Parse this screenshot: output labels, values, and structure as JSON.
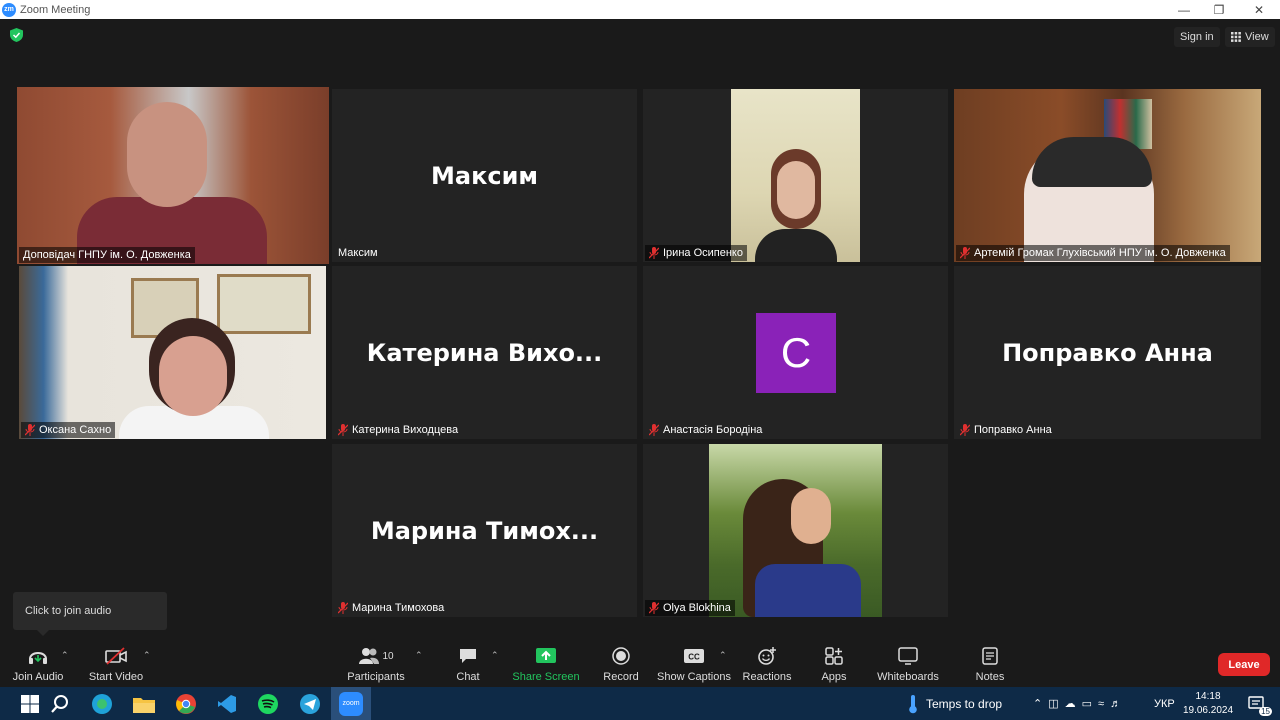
{
  "window": {
    "title": "Zoom Meeting",
    "logo_text": "zm"
  },
  "topbar": {
    "sign_in": "Sign in",
    "view": "View"
  },
  "tiles": [
    {
      "name": "Доповідач ГНПУ ім. О. Довженка",
      "type": "video",
      "active": true,
      "muted": false
    },
    {
      "name": "Максим",
      "big_name": "Максим",
      "type": "name",
      "muted": false
    },
    {
      "name": "Ірина Осипенко",
      "type": "video",
      "muted": true
    },
    {
      "name": "Артемій Громак Глухівський НПУ ім. О. Довженка",
      "type": "video",
      "muted": true
    },
    {
      "name": "Оксана Сахно",
      "type": "video",
      "muted": true
    },
    {
      "name": "Катерина Виходцева",
      "big_name": "Катерина  Вихо...",
      "type": "name",
      "muted": true
    },
    {
      "name": "Анастасія Бородіна",
      "avatar_letter": "C",
      "type": "avatar",
      "muted": true
    },
    {
      "name": "Поправко Анна",
      "big_name": "Поправко Анна",
      "type": "name",
      "muted": true
    },
    {
      "name": "Марина Тимохова",
      "big_name": "Марина  Тимох...",
      "type": "name",
      "muted": true
    },
    {
      "name": "Olya Blokhina",
      "type": "video",
      "muted": true
    }
  ],
  "tooltip": "Click to join audio",
  "toolbar": {
    "join_audio": "Join Audio",
    "start_video": "Start Video",
    "participants": "Participants",
    "participant_count": "10",
    "chat": "Chat",
    "share_screen": "Share Screen",
    "record": "Record",
    "show_captions": "Show Captions",
    "reactions": "Reactions",
    "apps": "Apps",
    "whiteboards": "Whiteboards",
    "notes": "Notes",
    "leave": "Leave"
  },
  "colors": {
    "active_speaker": "#dfe86a",
    "share_green": "#22c55e",
    "leave_red": "#e02828",
    "avatar_purple": "#8a22b8",
    "taskbar": "#0e2a47"
  },
  "taskbar": {
    "weather": "Temps to drop",
    "language": "УКР",
    "time": "14:18",
    "date": "19.06.2024",
    "notification_count": "15",
    "zoom_label": "zoom"
  }
}
